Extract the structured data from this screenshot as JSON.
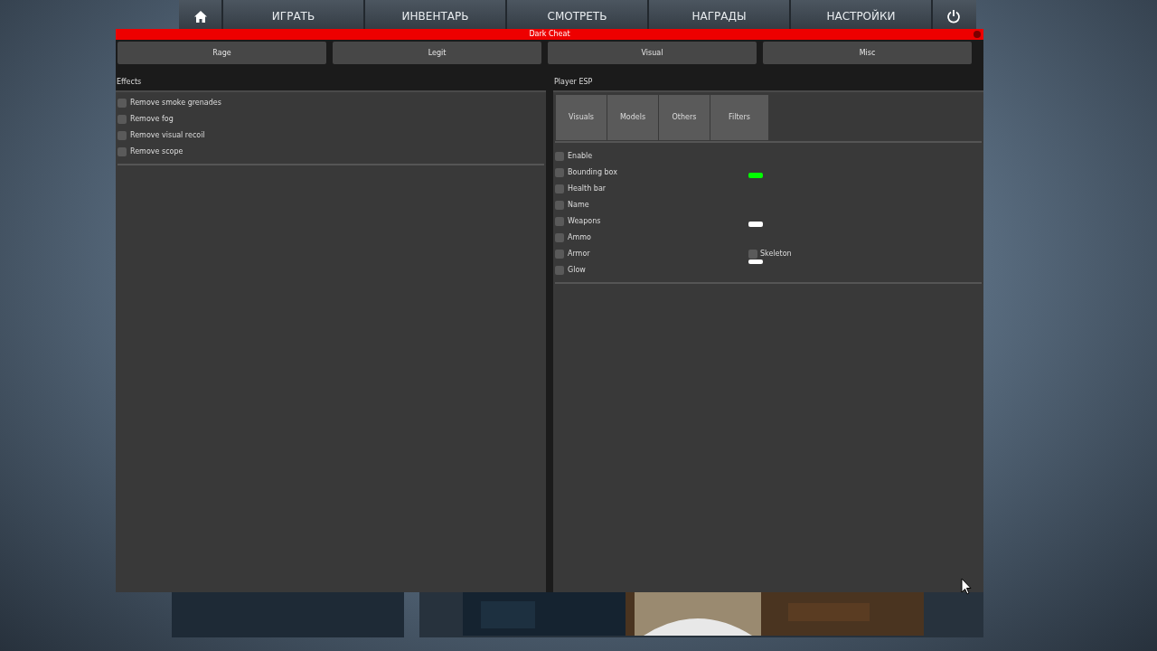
{
  "game_nav": {
    "items": [
      "ИГРАТЬ",
      "ИНВЕНТАРЬ",
      "СМОТРЕТЬ",
      "НАГРАДЫ",
      "НАСТРОЙКИ"
    ]
  },
  "window": {
    "title": "Dark Cheat"
  },
  "tabs": [
    {
      "label": "Rage"
    },
    {
      "label": "Legit"
    },
    {
      "label": "Visual"
    },
    {
      "label": "Misc"
    }
  ],
  "effects": {
    "title": "Effects",
    "options": [
      {
        "label": "Remove smoke grenades",
        "checked": false
      },
      {
        "label": "Remove fog",
        "checked": false
      },
      {
        "label": "Remove visual recoil",
        "checked": false
      },
      {
        "label": "Remove scope",
        "checked": false
      }
    ]
  },
  "player_esp": {
    "title": "Player ESP",
    "tabs": [
      {
        "label": "Visuals"
      },
      {
        "label": "Models"
      },
      {
        "label": "Others"
      },
      {
        "label": "Filters"
      }
    ],
    "options": [
      {
        "label": "Enable",
        "checked": false
      },
      {
        "label": "Bounding box",
        "checked": false,
        "color": "#00ff00"
      },
      {
        "label": "Health bar",
        "checked": false
      },
      {
        "label": "Name",
        "checked": false
      },
      {
        "label": "Weapons",
        "checked": false,
        "color": "#ffffff"
      },
      {
        "label": "Ammo",
        "checked": false
      },
      {
        "label": "Armor",
        "checked": false,
        "color": "#ffffff",
        "extra": {
          "label": "Skeleton",
          "checked": false
        }
      },
      {
        "label": "Glow",
        "checked": false
      }
    ]
  }
}
